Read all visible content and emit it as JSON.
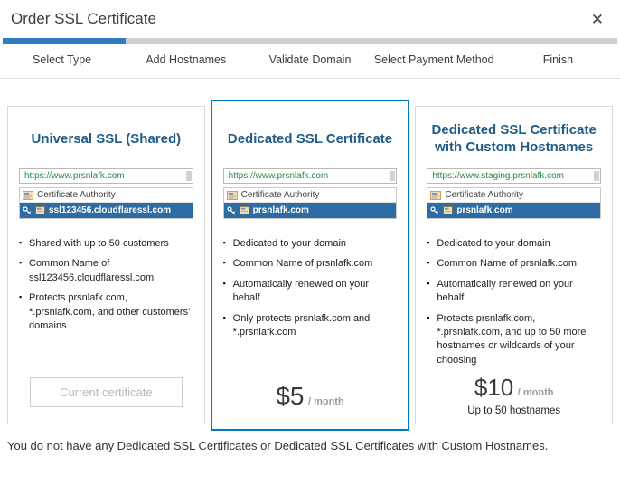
{
  "modal": {
    "title": "Order SSL Certificate",
    "close_glyph": "✕"
  },
  "progress": {
    "percent": 20,
    "active_step": "Select Type",
    "steps": [
      "Select Type",
      "Add Hostnames",
      "Validate Domain",
      "Select Payment Method",
      "Finish"
    ]
  },
  "colors": {
    "progress_blue": "#2f7cc0",
    "selected_card_border": "#0079c1",
    "card_title_blue": "#1f5c87",
    "highlight_row_blue": "#2e6da4",
    "url_green": "#2e8540"
  },
  "cards": [
    {
      "title": "Universal SSL (Shared)",
      "url": "https://www.prsnlafk.com",
      "ca_label": "Certificate Authority",
      "cert_name": "ssl123456.cloudflaressl.com",
      "bullets": [
        "Shared with up to 50 customers",
        "Common Name of ssl123456.cloudflaressl.com",
        "Protects prsnlafk.com, *.prsnlafk.com, and other customers’ domains"
      ],
      "button_label": "Current certificate"
    },
    {
      "title": "Dedicated SSL Certificate",
      "url": "https://www.prsnlafk.com",
      "ca_label": "Certificate Authority",
      "cert_name": "prsnlafk.com",
      "bullets": [
        "Dedicated to your domain",
        "Common Name of prsnlafk.com",
        "Automatically renewed on your behalf",
        "Only protects prsnlafk.com and *.prsnlafk.com"
      ],
      "price": "$5",
      "price_unit": "/ month"
    },
    {
      "title": "Dedicated SSL Certificate with Custom Hostnames",
      "url": "https://www.staging.prsnlafk.com",
      "ca_label": "Certificate Authority",
      "cert_name": "prsnlafk.com",
      "bullets": [
        "Dedicated to your domain",
        "Common Name of prsnlafk.com",
        "Automatically renewed on your behalf",
        "Protects prsnlafk.com, *.prsnlafk.com, and up to 50 more hostnames or wildcards of your choosing"
      ],
      "price": "$10",
      "price_unit": "/ month",
      "note": "Up to 50 hostnames"
    }
  ],
  "footer": "You do not have any Dedicated SSL Certificates or Dedicated SSL Certificates with Custom Hostnames."
}
